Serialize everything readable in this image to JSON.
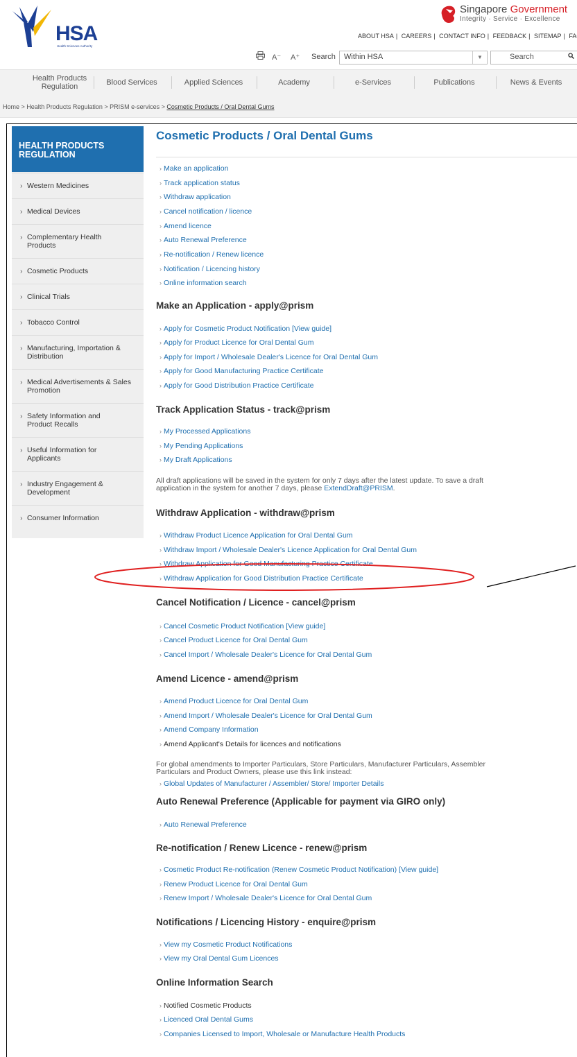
{
  "header": {
    "logo_text": "HSA",
    "logo_sub": "Health Sciences Authority",
    "gov_title_a": "Singapore ",
    "gov_title_b": "Government",
    "gov_tagline": "Integrity · Service · Excellence",
    "top_links": [
      "ABOUT HSA",
      "CAREERS",
      "CONTACT INFO",
      "FEEDBACK",
      "SITEMAP",
      "FAQS"
    ],
    "font_minus": "A⁻",
    "font_plus": "A⁺",
    "search_label": "Search",
    "scope_value": "Within HSA",
    "search_placeholder": "Search"
  },
  "nav": {
    "items": [
      "Health Products Regulation",
      "Blood Services",
      "Applied Sciences",
      "Academy",
      "e-Services",
      "Publications",
      "News & Events"
    ]
  },
  "breadcrumb": {
    "items": [
      "Home",
      "Health Products Regulation",
      "PRISM e-services"
    ],
    "sep": " > ",
    "current": "Cosmetic Products / Oral Dental Gums"
  },
  "sidebar": {
    "title": "HEALTH PRODUCTS REGULATION",
    "items": [
      "Western Medicines",
      "Medical Devices",
      "Complementary Health Products",
      "Cosmetic Products",
      "Clinical Trials",
      "Tobacco Control",
      "Manufacturing, Importation & Distribution",
      "Medical Advertisements & Sales Promotion",
      "Safety Information and Product Recalls",
      "Useful Information for Applicants",
      "Industry Engagement & Development",
      "Consumer Information"
    ]
  },
  "main": {
    "title": "Cosmetic Products / Oral Dental Gums",
    "quick_links": [
      "Make an application",
      "Track application status",
      "Withdraw application",
      "Cancel notification / licence",
      "Amend licence",
      "Auto Renewal Preference",
      "Re-notification / Renew licence",
      "Notification / Licencing history",
      "Online information search"
    ],
    "view_guide": "[View guide]",
    "apply": {
      "heading": "Make an Application - apply@prism",
      "links": [
        "Apply for Cosmetic Product Notification",
        "Apply for Product Licence for Oral Dental Gum",
        "Apply for Import / Wholesale Dealer's Licence for Oral Dental Gum",
        "Apply for Good Manufacturing Practice Certificate",
        "Apply for Good Distribution Practice Certificate"
      ]
    },
    "track": {
      "heading": "Track Application Status - track@prism",
      "links": [
        "My Processed Applications",
        "My Pending Applications",
        "My Draft Applications"
      ],
      "note_line1": "All draft applications will be saved in the system for only 7 days after the latest update. To save a draft",
      "note_line2": "application in the system for another 7 days, please ",
      "note_link": "ExtendDraft@PRISM",
      "note_end": "."
    },
    "withdraw": {
      "heading": "Withdraw Application - withdraw@prism",
      "links": [
        "Withdraw Product Licence Application for Oral Dental Gum",
        "Withdraw Import / Wholesale Dealer's Licence Application for Oral Dental Gum",
        "Withdraw Application for Good Manufacturing Practice Certificate",
        "Withdraw Application for Good Distribution Practice Certificate"
      ]
    },
    "cancel": {
      "heading": "Cancel Notification / Licence - cancel@prism",
      "links": [
        "Cancel Cosmetic Product Notification",
        "Cancel Product Licence for Oral Dental Gum",
        "Cancel Import / Wholesale Dealer's Licence for Oral Dental Gum"
      ]
    },
    "amend": {
      "heading": "Amend Licence - amend@prism",
      "links": [
        "Amend Product Licence for Oral Dental Gum",
        "Amend Import / Wholesale Dealer's Licence for Oral Dental Gum",
        "Amend Company Information",
        "Amend Applicant's Details for licences and notifications"
      ],
      "note_line1": "For global amendments to Importer Particulars, Store Particulars, Manufacturer Particulars, Assembler",
      "note_line2": "Particulars and Product Owners, please use this link instead:",
      "global_link": "Global Updates of Manufacturer / Assembler/ Store/ Importer Details"
    },
    "auto": {
      "heading": "Auto Renewal Preference (Applicable for payment via GIRO only)",
      "links": [
        "Auto Renewal Preference"
      ]
    },
    "renew": {
      "heading": "Re-notification / Renew Licence - renew@prism",
      "links": [
        "Cosmetic Product Re-notification (Renew Cosmetic Product Notification)",
        "Renew Product Licence for Oral Dental Gum",
        "Renew Import / Wholesale Dealer's Licence for Oral Dental Gum"
      ]
    },
    "history": {
      "heading": "Notifications / Licencing History - enquire@prism",
      "links": [
        "View my Cosmetic Product Notifications",
        "View my Oral Dental Gum Licences"
      ]
    },
    "search": {
      "heading": "Online Information Search",
      "links": [
        "Notified Cosmetic Products",
        "Licenced Oral Dental Gums",
        "Companies Licensed to Import, Wholesale or Manufacture Health Products"
      ]
    }
  },
  "colors": {
    "link_blue": "#1f6faf",
    "brand_navy": "#1c3f94",
    "gov_red": "#d61f26",
    "annotation_red": "#e02020"
  }
}
